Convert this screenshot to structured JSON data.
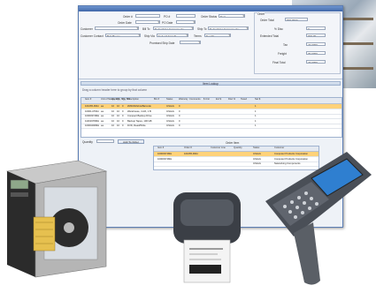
{
  "header": {
    "order_no_label": "Order #",
    "order_date_label": "Order Date",
    "po_no_label": "PO #",
    "po_date_label": "PO Date",
    "order_status_label": "Order Status",
    "order_status_value": "New",
    "totals_label": "Order",
    "customer_label": "Customer",
    "bill_to_label": "Bill To",
    "ship_to_label": "Ship To",
    "bill_to_value": "Networking Components",
    "ship_to_value": "Networking Components",
    "customer_contact_label": "Customer Contact",
    "customer_contact_value": "Bob Brown",
    "ship_via_label": "Ship Via",
    "ship_via_value": "Federal Freight",
    "terms_label": "Terms",
    "terms_value": "Net 30",
    "promised_date_label": "Promised Ship Date",
    "order_total_label": "Order Total",
    "order_total_value": "000.0000",
    "pct_disc_label": "% Disc",
    "pct_disc_value": "0",
    "extended_total_label": "Extended Total",
    "extended_total_value": "000.00",
    "tax_label": "Tax",
    "tax_value": "27.0000",
    "freight_label": "Freight",
    "freight_value": "30.0000",
    "final_total_label": "Final Total",
    "final_total_value": "27.0000"
  },
  "item_lookup_label": "Item Lookup",
  "group_hint": "Drag a column header here to group by that column",
  "grid": {
    "columns": [
      "Item #",
      "Unit of Measure",
      "Qty Ord",
      "Qty Shp",
      "Qty B/O",
      "Description",
      "Bin #",
      "Status",
      "Warranty",
      "Comments",
      "$ Unit",
      "Ext $",
      "Disc %",
      "Taxed",
      "Net $"
    ],
    "rows": [
      [
        "101065-3MH",
        "ea",
        "10",
        "10",
        "0",
        "ZM400/Zebra/Barcode",
        "",
        "InStock",
        "0",
        "",
        "",
        "",
        "",
        "",
        "1"
      ],
      [
        "10001-07MH",
        "ea",
        "10",
        "10",
        "0",
        "Warehouse, 4 Ath, 1 B",
        "",
        "InStock",
        "0",
        "",
        "",
        "",
        "",
        "",
        "1"
      ],
      [
        "10000374MH",
        "ea",
        "10",
        "10",
        "0",
        "Compact Backup Drive",
        "",
        "InStock",
        "0",
        "",
        "",
        "",
        "",
        "",
        "1"
      ],
      [
        "11001978MH",
        "ea",
        "10",
        "10",
        "0",
        "Backup Tapes, 100 GB",
        "",
        "InStock",
        "0",
        "",
        "",
        "",
        "",
        "",
        "1"
      ],
      [
        "10000400MH",
        "ea",
        "10",
        "10",
        "0",
        "DVD, Read/Write",
        "",
        "InStock",
        "0",
        "",
        "",
        "",
        "",
        "",
        "1"
      ]
    ]
  },
  "quantity_label": "Quantity",
  "add_button_label": "Add To Order",
  "order_item_label": "Order Item",
  "sub_grid": {
    "columns": [
      "Item #",
      "Order #",
      "Customer Line",
      "Quantity",
      "Status",
      "Customer"
    ],
    "rows": [
      [
        "10000374MH",
        "101065-3MH",
        "",
        "",
        "InStock",
        "Computer Products Corporation"
      ],
      [
        "10000374MH",
        "",
        "",
        "",
        "InStock",
        "Computer Products Corporation"
      ],
      [
        "",
        "",
        "",
        "",
        "InStock",
        "Networking Components"
      ]
    ]
  },
  "colors": {
    "accent": "#3f66a8",
    "highlight": "#ffd27a"
  }
}
